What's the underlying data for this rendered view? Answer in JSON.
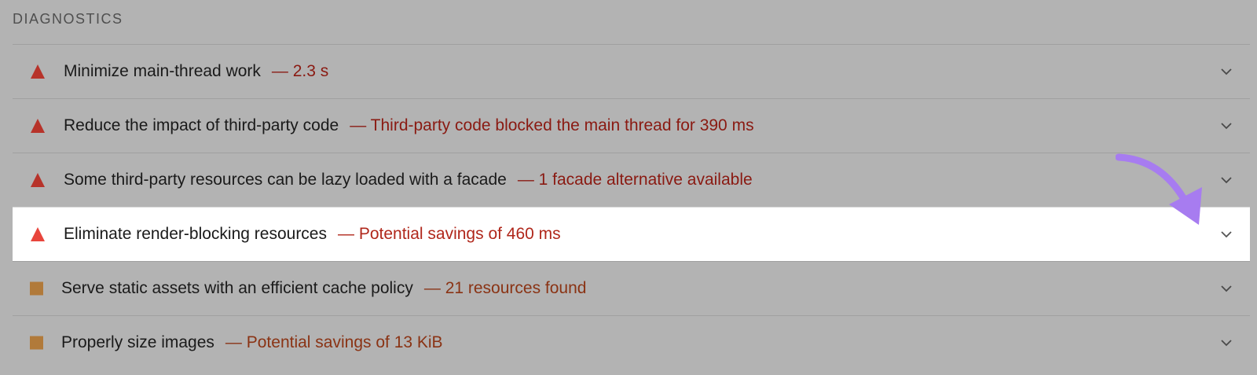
{
  "section": {
    "title": "DIAGNOSTICS"
  },
  "colors": {
    "fail_triangle": "#b7332a",
    "fail_triangle_highlight": "#e8453c",
    "warn_square": "#b17a3a",
    "annotation_arrow": "#a77cf0"
  },
  "audits": [
    {
      "title": "Minimize main-thread work",
      "separator": "—",
      "display_value": "2.3 s",
      "severity_icon": "warning-triangle-icon",
      "expand_icon": "chevron-down-icon"
    },
    {
      "title": "Reduce the impact of third-party code",
      "separator": "—",
      "display_value": "Third-party code blocked the main thread for 390 ms",
      "severity_icon": "warning-triangle-icon",
      "expand_icon": "chevron-down-icon"
    },
    {
      "title": "Some third-party resources can be lazy loaded with a facade",
      "separator": "—",
      "display_value": "1 facade alternative available",
      "severity_icon": "warning-triangle-icon",
      "expand_icon": "chevron-down-icon"
    },
    {
      "title": "Eliminate render-blocking resources",
      "separator": "—",
      "display_value": "Potential savings of 460 ms",
      "severity_icon": "warning-triangle-icon",
      "expand_icon": "chevron-down-icon",
      "highlighted": true
    },
    {
      "title": "Serve static assets with an efficient cache policy",
      "separator": "—",
      "display_value": "21 resources found",
      "severity_icon": "square-icon",
      "expand_icon": "chevron-down-icon"
    },
    {
      "title": "Properly size images",
      "separator": "—",
      "display_value": "Potential savings of 13 KiB",
      "severity_icon": "square-icon",
      "expand_icon": "chevron-down-icon"
    }
  ]
}
